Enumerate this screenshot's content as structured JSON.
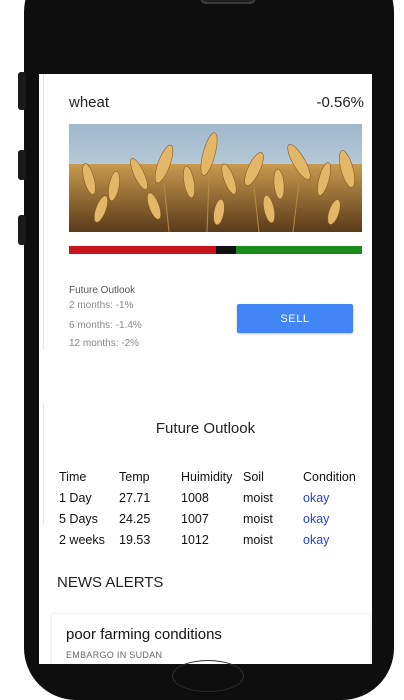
{
  "crop": {
    "name": "wheat",
    "change": "-0.56%",
    "image_icon": "wheat-field-photo"
  },
  "price_bar": {
    "colors": {
      "negative": "#c8141a",
      "marker": "#111111",
      "positive": "#1a8a1a"
    }
  },
  "outlook": {
    "title": "Future Outlook",
    "lines": [
      "2 months: -1%",
      "6 months: -1.4%",
      "12 months: -2%"
    ]
  },
  "sell_button": {
    "label": "SELL",
    "color": "#4285f4"
  },
  "forecast": {
    "title": "Future Outlook",
    "headers": [
      "Time",
      "Temp",
      "Huimidity",
      "Soil",
      "Condition"
    ],
    "rows": [
      [
        "1 Day",
        "27.71",
        "1008",
        "moist",
        "okay"
      ],
      [
        "5 Days",
        "24.25",
        "1007",
        "moist",
        "okay"
      ],
      [
        "2 weeks",
        "19.53",
        "1012",
        "moist",
        "okay"
      ]
    ]
  },
  "news": {
    "title": "NEWS ALERTS",
    "items": [
      {
        "headline": "poor farming conditions",
        "subtext": "EMBARGO IN SUDAN"
      }
    ]
  }
}
